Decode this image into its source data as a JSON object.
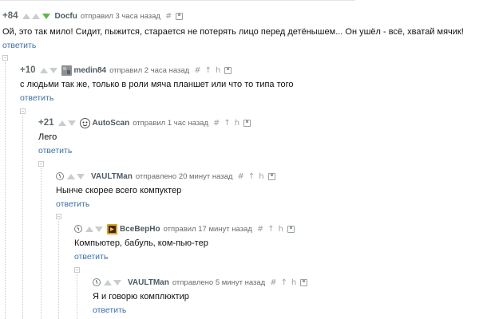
{
  "comments": [
    {
      "rating": "+84",
      "author": "Docfu",
      "posted": "отправил 3 часа назад",
      "text": "Ой, это так мило! Сидит, пыжится, старается не потерять лицо перед детёнышем... Он ушёл - всё, хватай мячик!",
      "reply": "ответить"
    },
    {
      "rating": "+10",
      "author": "medin84",
      "posted": "отправил 2 часа назад",
      "text": "с людьми так же, только в роли мяча планшет или что то типа того",
      "reply": "ответить"
    },
    {
      "rating": "+21",
      "author": "AutoScan",
      "posted": "отправил 1 час назад",
      "text": "Лего",
      "reply": "ответить"
    },
    {
      "rating": "",
      "author": "VAULTMan",
      "posted": "отправлено 20 минут назад",
      "text": "Нынче скорее всего компуктер",
      "reply": "ответить"
    },
    {
      "rating": "",
      "author": "ВсеВерНо",
      "posted": "отправил 17 минут назад",
      "text": "Компьютер, бабуль, ком-пью-тер",
      "reply": "ответить"
    },
    {
      "rating": "",
      "author": "VAULTMan",
      "posted": "отправлено 5 минут назад",
      "text": "Я и говорю комплюктир",
      "reply": "ответить"
    }
  ],
  "tools": {
    "hash": "#",
    "branch": "↑",
    "link": "h"
  },
  "colors": {
    "rating": "#5f6a6f",
    "author": "#4b5a63",
    "reply_link": "#3a6fb0",
    "vote_inactive": "#c9cdd0",
    "vote_active": "#5cb84b"
  }
}
